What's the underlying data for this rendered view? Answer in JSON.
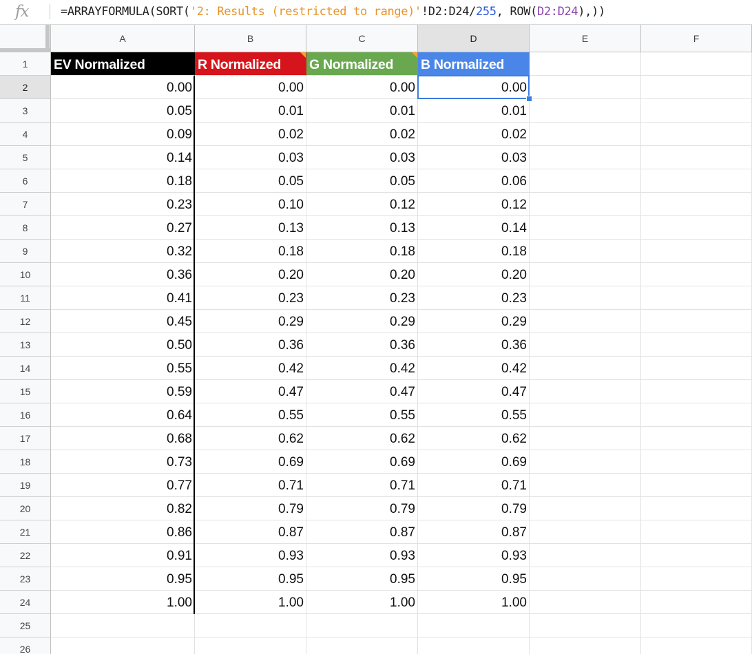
{
  "formula_bar": {
    "fx_label": "fx",
    "segments": [
      {
        "text": "=ARRAYFORMULA(SORT(",
        "color": "#222222"
      },
      {
        "text": "'2: Results (restricted to range)'",
        "color": "#e8932b"
      },
      {
        "text": "!D2:D24",
        "color": "#222222"
      },
      {
        "text": "/",
        "color": "#222222"
      },
      {
        "text": "255",
        "color": "#2a59d6"
      },
      {
        "text": ", ROW(",
        "color": "#222222"
      },
      {
        "text": "D2:D24",
        "color": "#8e44ad"
      },
      {
        "text": "),))",
        "color": "#222222"
      }
    ]
  },
  "columns": [
    "A",
    "B",
    "C",
    "D",
    "E",
    "F"
  ],
  "active_column": "D",
  "active_row": 2,
  "headers": [
    {
      "label": "EV Normalized",
      "color": "#000000",
      "note": false
    },
    {
      "label": "R Normalized",
      "color": "#d6141b",
      "note": true
    },
    {
      "label": "G Normalized",
      "color": "#6aa84f",
      "note": true
    },
    {
      "label": "B Normalized",
      "color": "#4a86e8",
      "note": false
    }
  ],
  "rows": [
    [
      "0.00",
      "0.00",
      "0.00",
      "0.00"
    ],
    [
      "0.05",
      "0.01",
      "0.01",
      "0.01"
    ],
    [
      "0.09",
      "0.02",
      "0.02",
      "0.02"
    ],
    [
      "0.14",
      "0.03",
      "0.03",
      "0.03"
    ],
    [
      "0.18",
      "0.05",
      "0.05",
      "0.06"
    ],
    [
      "0.23",
      "0.10",
      "0.12",
      "0.12"
    ],
    [
      "0.27",
      "0.13",
      "0.13",
      "0.14"
    ],
    [
      "0.32",
      "0.18",
      "0.18",
      "0.18"
    ],
    [
      "0.36",
      "0.20",
      "0.20",
      "0.20"
    ],
    [
      "0.41",
      "0.23",
      "0.23",
      "0.23"
    ],
    [
      "0.45",
      "0.29",
      "0.29",
      "0.29"
    ],
    [
      "0.50",
      "0.36",
      "0.36",
      "0.36"
    ],
    [
      "0.55",
      "0.42",
      "0.42",
      "0.42"
    ],
    [
      "0.59",
      "0.47",
      "0.47",
      "0.47"
    ],
    [
      "0.64",
      "0.55",
      "0.55",
      "0.55"
    ],
    [
      "0.68",
      "0.62",
      "0.62",
      "0.62"
    ],
    [
      "0.73",
      "0.69",
      "0.69",
      "0.69"
    ],
    [
      "0.77",
      "0.71",
      "0.71",
      "0.71"
    ],
    [
      "0.82",
      "0.79",
      "0.79",
      "0.79"
    ],
    [
      "0.86",
      "0.87",
      "0.87",
      "0.87"
    ],
    [
      "0.91",
      "0.93",
      "0.93",
      "0.93"
    ],
    [
      "0.95",
      "0.95",
      "0.95",
      "0.95"
    ],
    [
      "1.00",
      "1.00",
      "1.00",
      "1.00"
    ]
  ],
  "row_numbers": [
    "1",
    "2",
    "3",
    "4",
    "5",
    "6",
    "7",
    "8",
    "9",
    "10",
    "11",
    "12",
    "13",
    "14",
    "15",
    "16",
    "17",
    "18",
    "19",
    "20",
    "21",
    "22",
    "23",
    "24",
    "25",
    "26"
  ]
}
